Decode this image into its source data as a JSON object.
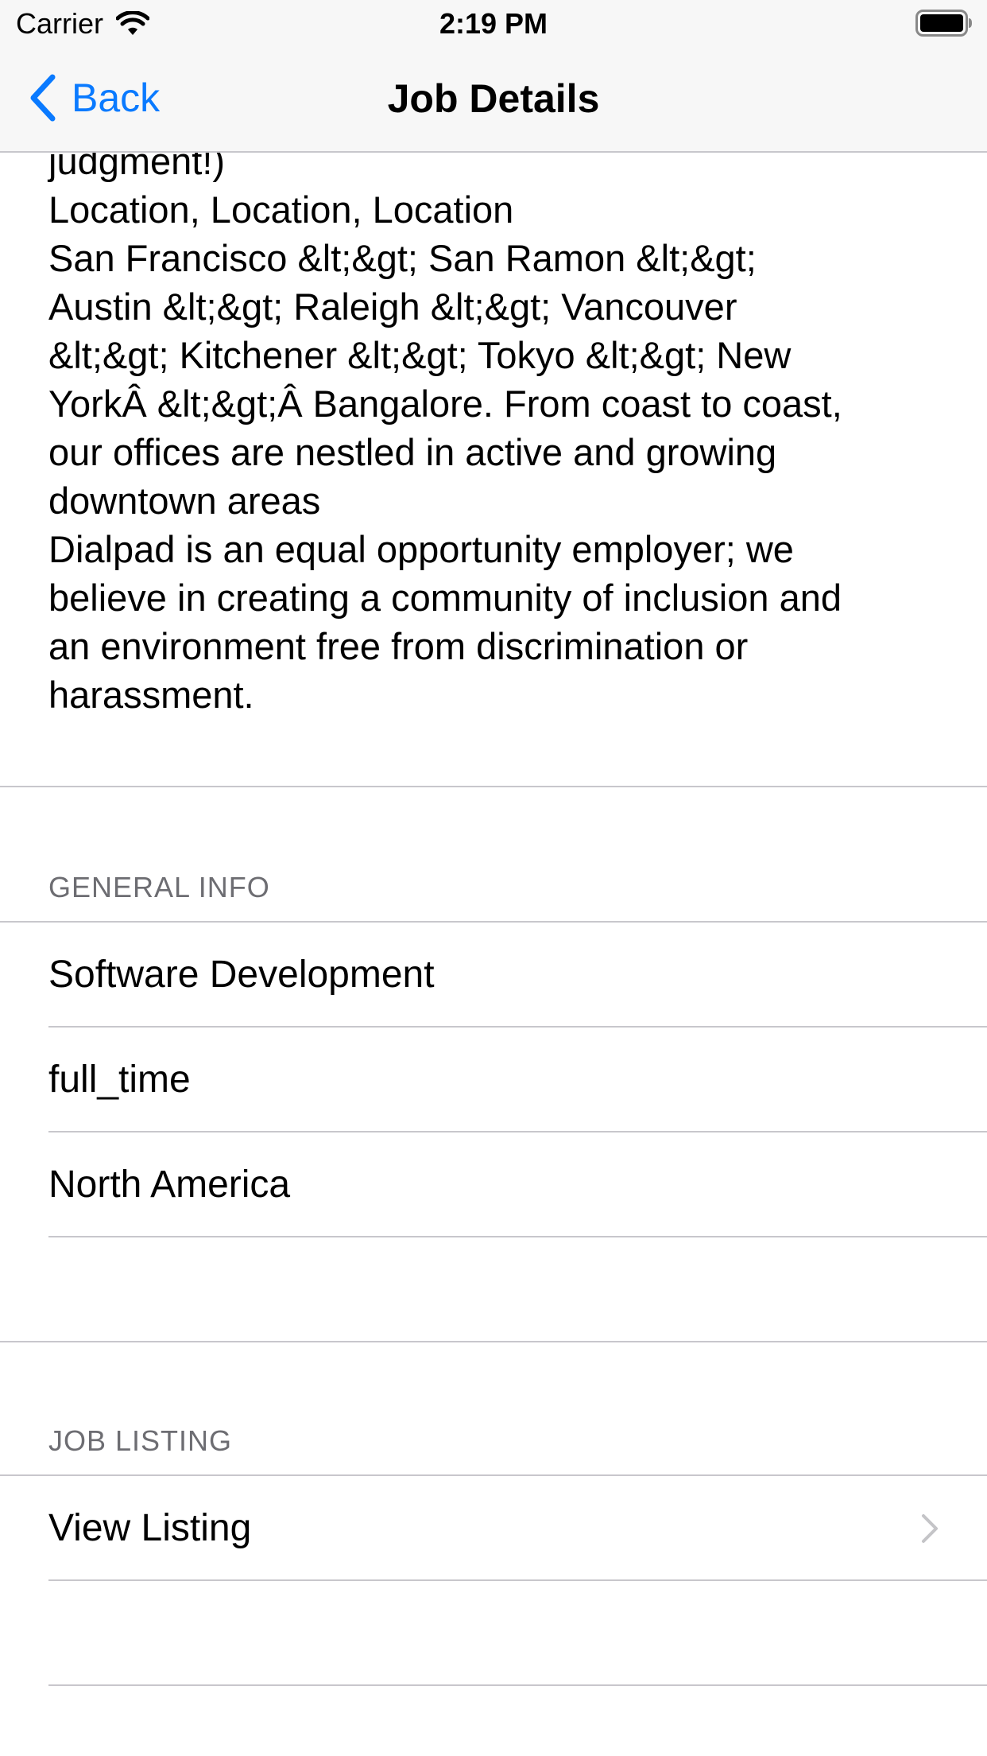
{
  "status_bar": {
    "carrier": "Carrier",
    "time": "2:19 PM",
    "wifi_icon": "wifi-icon",
    "battery_icon": "battery-icon"
  },
  "nav": {
    "back_label": "Back",
    "back_icon": "chevron-left-icon",
    "title": "Job Details",
    "tint_color": "#0a7aff"
  },
  "description": {
    "lines": [
      "judgment!)",
      "Location, Location, Location",
      "San Francisco &lt;&gt; San Ramon &lt;&gt;",
      "Austin &lt;&gt; Raleigh &lt;&gt; Vancouver",
      "&lt;&gt; Kitchener &lt;&gt; Tokyo &lt;&gt; New",
      "YorkÂ &lt;&gt;Â Bangalore. From coast to coast,",
      "our offices are nestled in active and growing",
      "downtown areas",
      "Dialpad is an equal opportunity employer; we",
      "believe in creating a community of inclusion and",
      "an environment free from discrimination or",
      "harassment."
    ]
  },
  "general_info": {
    "header": "GENERAL INFO",
    "rows": [
      {
        "label": "Software Development"
      },
      {
        "label": "full_time"
      },
      {
        "label": "North America"
      }
    ]
  },
  "job_listing": {
    "header": "JOB LISTING",
    "rows": [
      {
        "label": "View Listing",
        "accessory": "chevron-right-icon"
      }
    ]
  },
  "colors": {
    "separator": "#c8c7cc",
    "header_text": "#6d6d72",
    "nav_background": "#f7f7f7"
  }
}
